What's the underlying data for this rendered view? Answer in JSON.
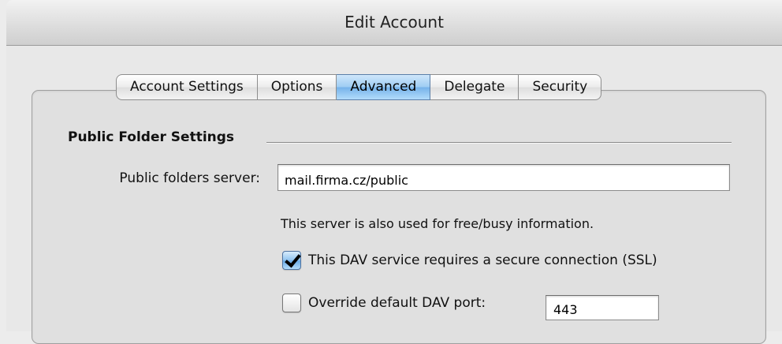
{
  "window": {
    "title": "Edit Account"
  },
  "tabs": [
    {
      "label": "Account Settings",
      "selected": false
    },
    {
      "label": "Options",
      "selected": false
    },
    {
      "label": "Advanced",
      "selected": true
    },
    {
      "label": "Delegate",
      "selected": false
    },
    {
      "label": "Security",
      "selected": false
    }
  ],
  "public_folder": {
    "section_title": "Public Folder Settings",
    "server_label": "Public folders server:",
    "server_value": "mail.firma.cz/public",
    "note": "This server is also used for free/busy information.",
    "ssl_checkbox": {
      "label": "This DAV service requires a secure connection (SSL)",
      "checked": true
    },
    "port_checkbox": {
      "label": "Override default DAV port:",
      "checked": false
    },
    "port_value": "443"
  },
  "colors": {
    "selected_tab": "#8fc3f0",
    "window_background": "#ececec"
  }
}
